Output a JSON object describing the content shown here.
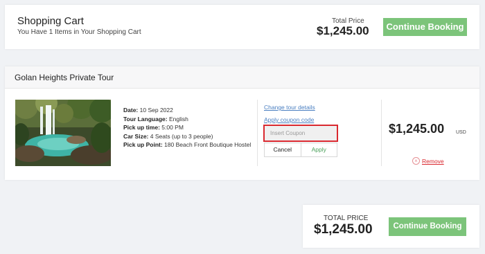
{
  "header": {
    "title": "Shopping Cart",
    "subtitle": "You Have 1 Items in Your Shopping Cart",
    "total_label": "Total Price",
    "total_value": "$1,245.00",
    "continue_label": "Continue Booking"
  },
  "tour": {
    "name": "Golan Heights Private Tour",
    "details": [
      {
        "label": "Date:",
        "value": "10 Sep 2022"
      },
      {
        "label": "Tour Language:",
        "value": "English"
      },
      {
        "label": "Pick up time:",
        "value": "5:00 PM"
      },
      {
        "label": "Car Size:",
        "value": "4 Seats (up to 3 people)"
      },
      {
        "label": "Pick up Point:",
        "value": "180 Beach Front Boutique Hostel"
      }
    ],
    "change_link": "Change tour details",
    "coupon_link": "Apply coupon code",
    "coupon_placeholder": "Insert Coupon",
    "cancel_label": "Cancel",
    "apply_label": "Apply",
    "price": "$1,245.00",
    "currency": "USD",
    "remove_label": "Remove"
  },
  "footer": {
    "total_label": "TOTAL PRICE",
    "total_value": "$1,245.00",
    "continue_label": "Continue Booking"
  },
  "colors": {
    "accent_green": "#7cc47a",
    "link_blue": "#4a7fc1",
    "alert_red": "#d9282f"
  }
}
